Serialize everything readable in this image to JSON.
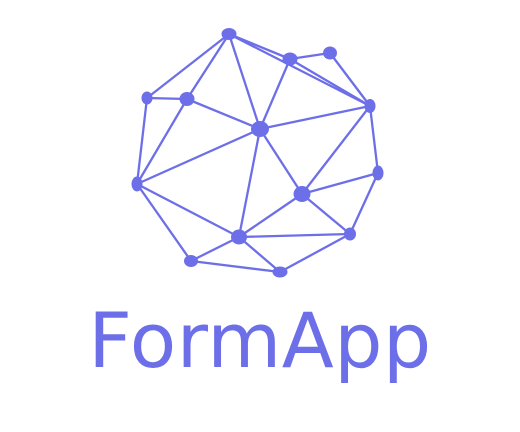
{
  "brand": {
    "name": "FormApp",
    "color": "#6d6fe8",
    "logo_icon": "geodesic-network-icon"
  }
}
